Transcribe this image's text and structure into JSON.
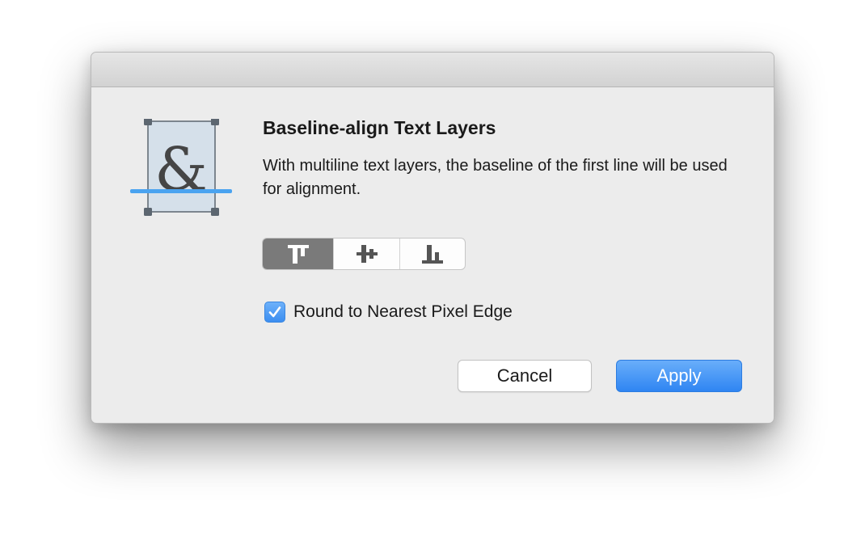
{
  "dialog": {
    "title": "Baseline-align Text Layers",
    "message": "With multiline text layers, the baseline of the first line will be used for alignment.",
    "app_icon": "text-baseline-icon",
    "icon_glyph": "&",
    "alignment_segments": [
      {
        "id": "top",
        "icon": "align-top-icon",
        "selected": true
      },
      {
        "id": "middle",
        "icon": "align-middle-icon",
        "selected": false
      },
      {
        "id": "bottom",
        "icon": "align-bottom-icon",
        "selected": false
      }
    ],
    "round_checkbox": {
      "label": "Round to Nearest Pixel Edge",
      "checked": true
    },
    "cancel_label": "Cancel",
    "apply_label": "Apply"
  },
  "colors": {
    "accent": "#3c8ef0",
    "baseline": "#4aa3f0",
    "selected_segment": "#7a7a7a"
  }
}
